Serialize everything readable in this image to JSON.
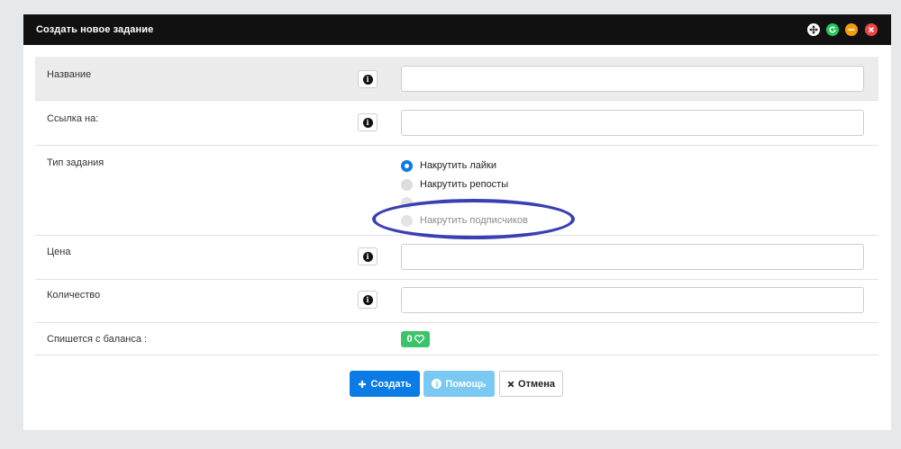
{
  "window": {
    "title": "Создать новое задание",
    "controls": [
      {
        "name": "move-icon",
        "color": "#ffffff"
      },
      {
        "name": "refresh-icon",
        "color": "#22c55e"
      },
      {
        "name": "minimize-icon",
        "color": "#f59e0b"
      },
      {
        "name": "close-icon",
        "color": "#ef4444"
      }
    ]
  },
  "form": {
    "name_label": "Название",
    "name_value": "",
    "link_label": "Ссылка на:",
    "link_value": "",
    "type_label": "Тип задания",
    "type_options": [
      {
        "label": "Накрутить лайки",
        "checked": true
      },
      {
        "label": "Накрутить репосты",
        "checked": false
      },
      {
        "label": "Накрутить подписчиков",
        "checked": false
      }
    ],
    "price_label": "Цена",
    "price_value": "",
    "quantity_label": "Количество",
    "quantity_value": "",
    "balance_label": "Спишется с баланса :",
    "balance_value": "0",
    "balance_icon": "heart-icon"
  },
  "buttons": {
    "create": "Создать",
    "help": "Помощь",
    "cancel": "Отмена"
  },
  "colors": {
    "titlebar": "#111111",
    "primary": "#0b7be5",
    "info": "#79c9f3",
    "success": "#3cc46a",
    "annotation": "#3b3fb3"
  }
}
